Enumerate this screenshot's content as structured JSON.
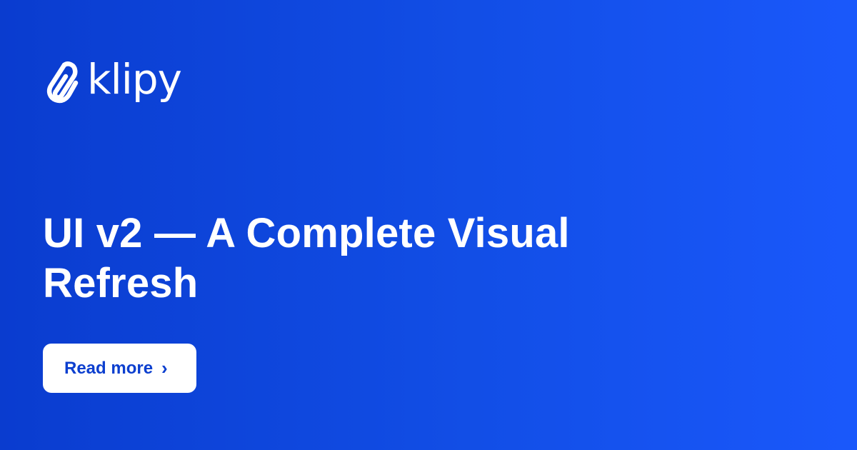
{
  "brand": {
    "name": "klipy",
    "logo_icon": "paperclip-icon"
  },
  "headline": {
    "text": "UI v2 — A Complete Visual Refresh"
  },
  "cta": {
    "label": "Read more",
    "icon": "chevron-right-icon",
    "chevron": "›"
  },
  "colors": {
    "background_start": "#0a3ccf",
    "background_end": "#1a58fb",
    "button_bg": "#ffffff",
    "button_text": "#0c3fcf",
    "text": "#ffffff"
  }
}
